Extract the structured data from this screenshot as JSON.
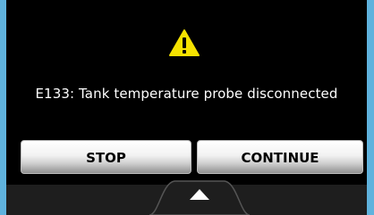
{
  "dialog": {
    "icon": "warning-icon",
    "message": "E133: Tank temperature probe disconnected"
  },
  "buttons": {
    "stop_label": "STOP",
    "continue_label": "CONTINUE"
  },
  "drawer": {
    "icon": "chevron-up-icon"
  },
  "colors": {
    "frame": "#5fb2dd",
    "screen": "#000000",
    "warning": "#f5e200",
    "button_top": "#ffffff",
    "button_bottom": "#8f8f8f"
  }
}
